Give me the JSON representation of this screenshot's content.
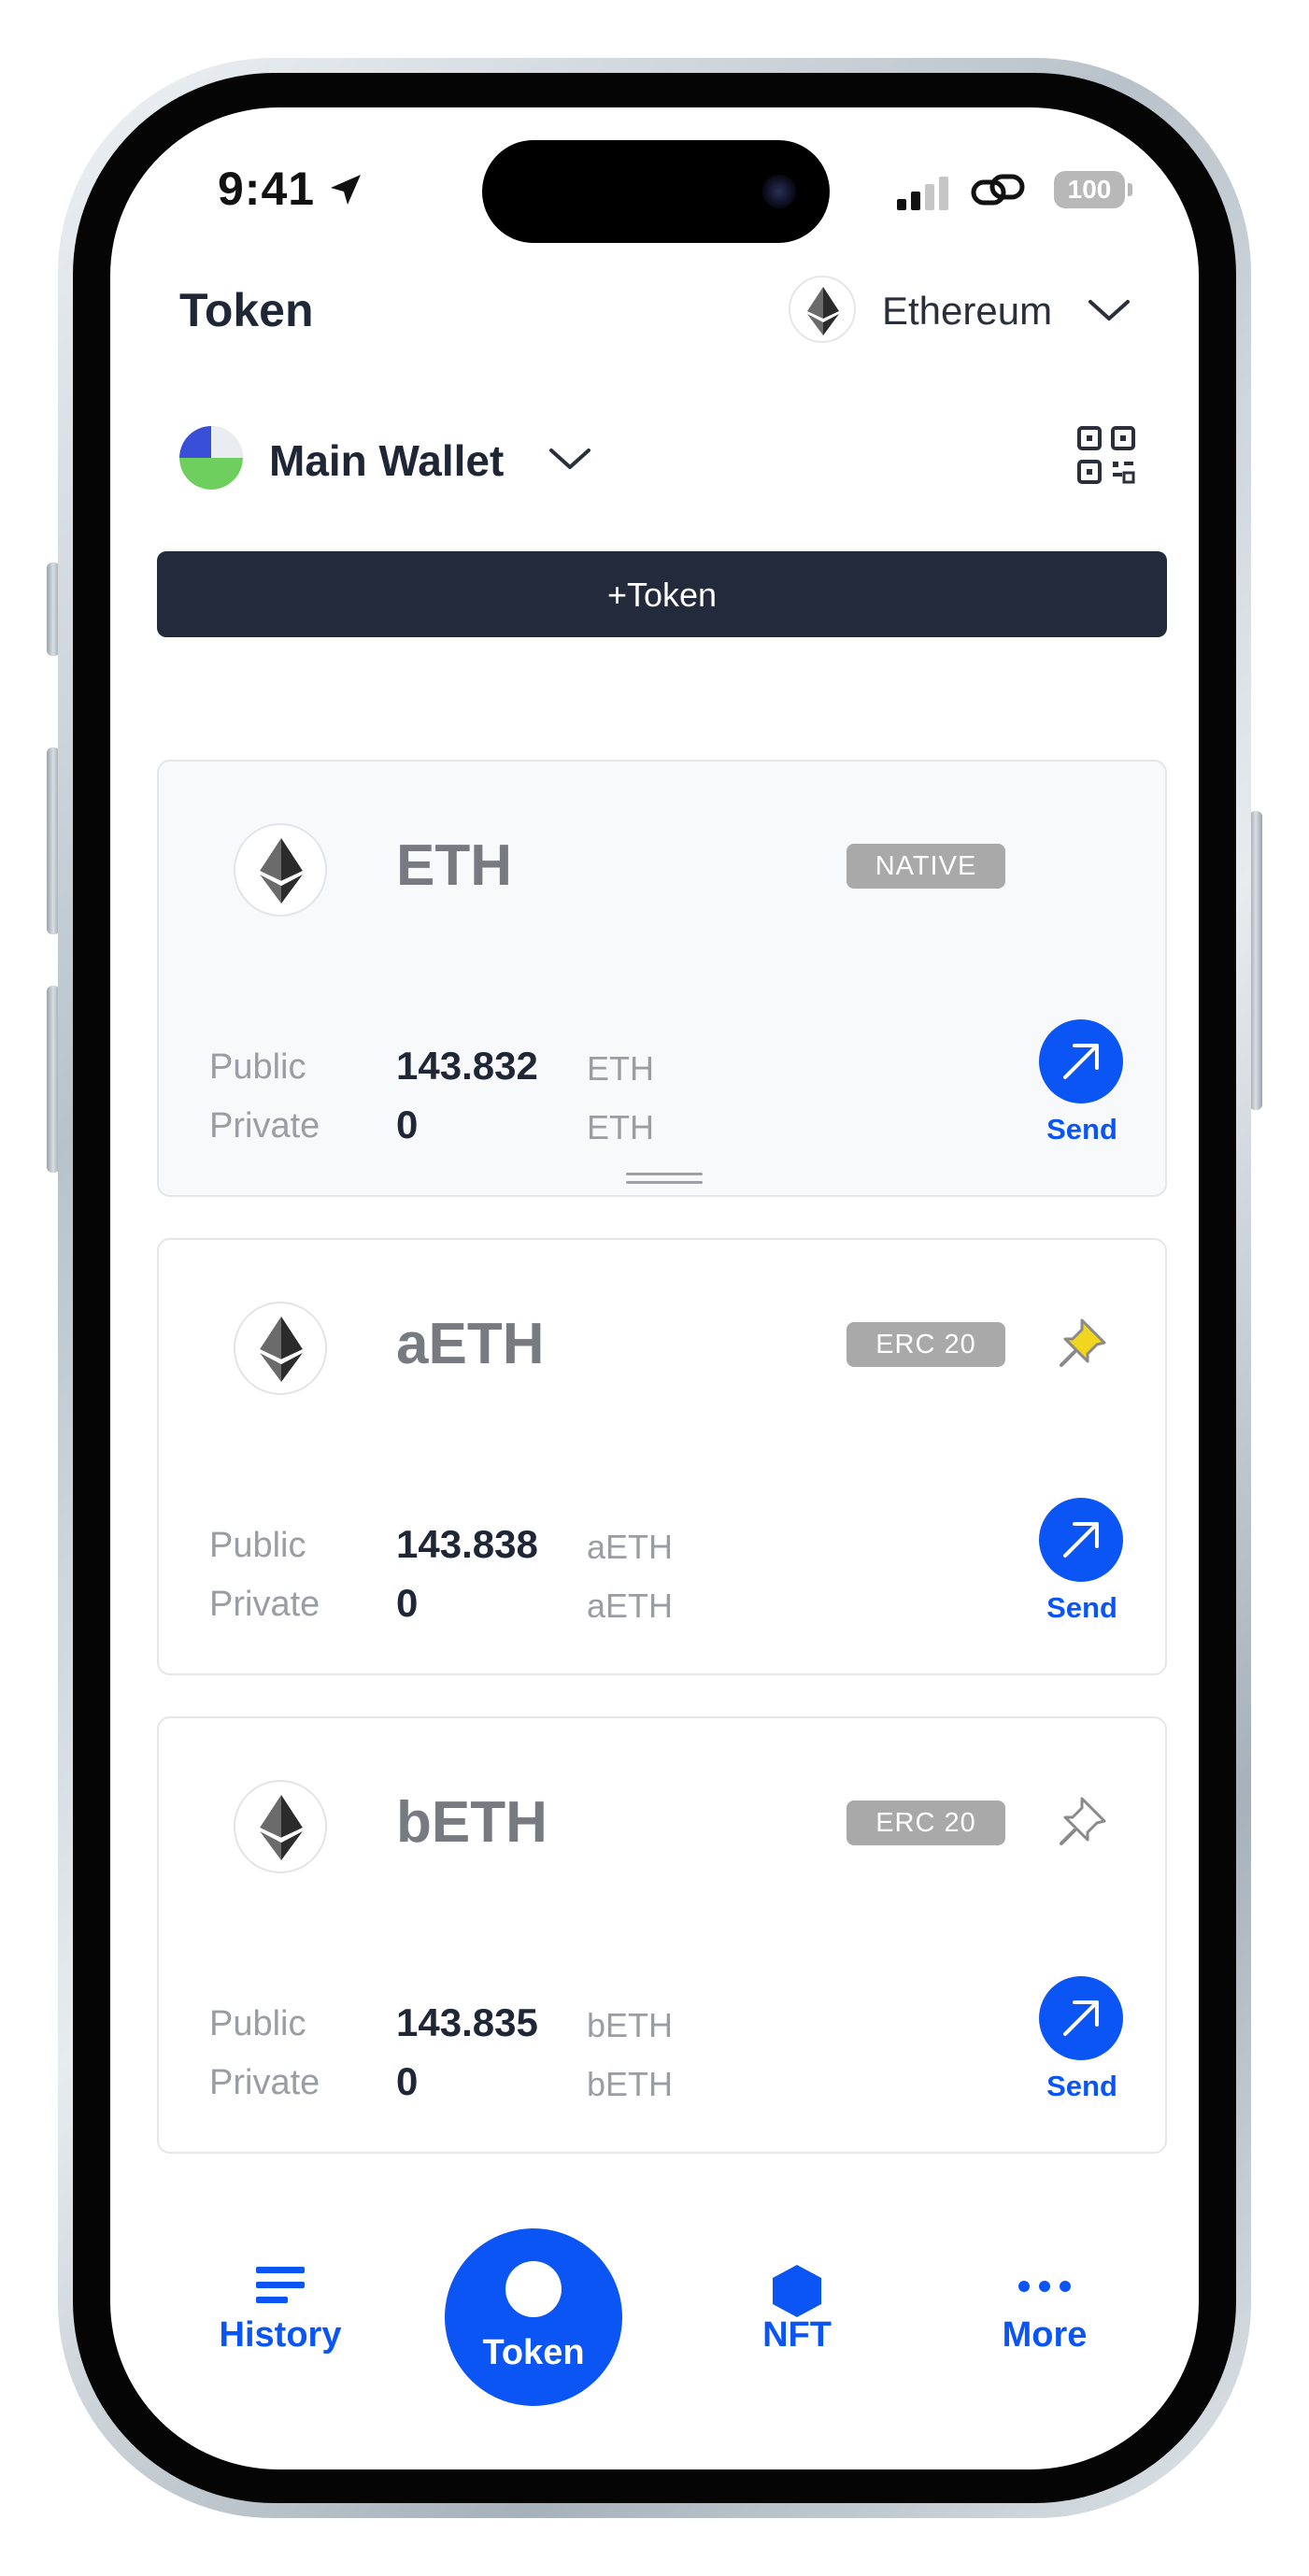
{
  "status_bar": {
    "time": "9:41",
    "battery": "100"
  },
  "header": {
    "title": "Token",
    "network": "Ethereum"
  },
  "wallet": {
    "name": "Main Wallet"
  },
  "actions": {
    "add_token": "+Token"
  },
  "tokens": [
    {
      "symbol": "ETH",
      "badge": "NATIVE",
      "public_label": "Public",
      "public_value": "143.832",
      "public_unit": "ETH",
      "private_label": "Private",
      "private_value": "0",
      "private_unit": "ETH",
      "send_label": "Send",
      "pinned": null
    },
    {
      "symbol": "aETH",
      "badge": "ERC 20",
      "public_label": "Public",
      "public_value": "143.838",
      "public_unit": "aETH",
      "private_label": "Private",
      "private_value": "0",
      "private_unit": "aETH",
      "send_label": "Send",
      "pinned": true
    },
    {
      "symbol": "bETH",
      "badge": "ERC 20",
      "public_label": "Public",
      "public_value": "143.835",
      "public_unit": "bETH",
      "private_label": "Private",
      "private_value": "0",
      "private_unit": "bETH",
      "send_label": "Send",
      "pinned": false
    }
  ],
  "nav": {
    "history": "History",
    "token": "Token",
    "nft": "NFT",
    "more": "More"
  },
  "colors": {
    "accent": "#0b55f5",
    "dark_button": "#222a3b",
    "title_text": "#1f2737",
    "badge": "#a9a9a9",
    "pin_active": "#f2d51f"
  },
  "icons": [
    "location-arrow-icon",
    "signal-icon",
    "link-icon",
    "ethereum-icon",
    "chevron-down-icon",
    "qr-code-icon",
    "pin-icon",
    "send-arrow-icon",
    "list-icon",
    "hexagon-icon",
    "more-dots-icon"
  ]
}
